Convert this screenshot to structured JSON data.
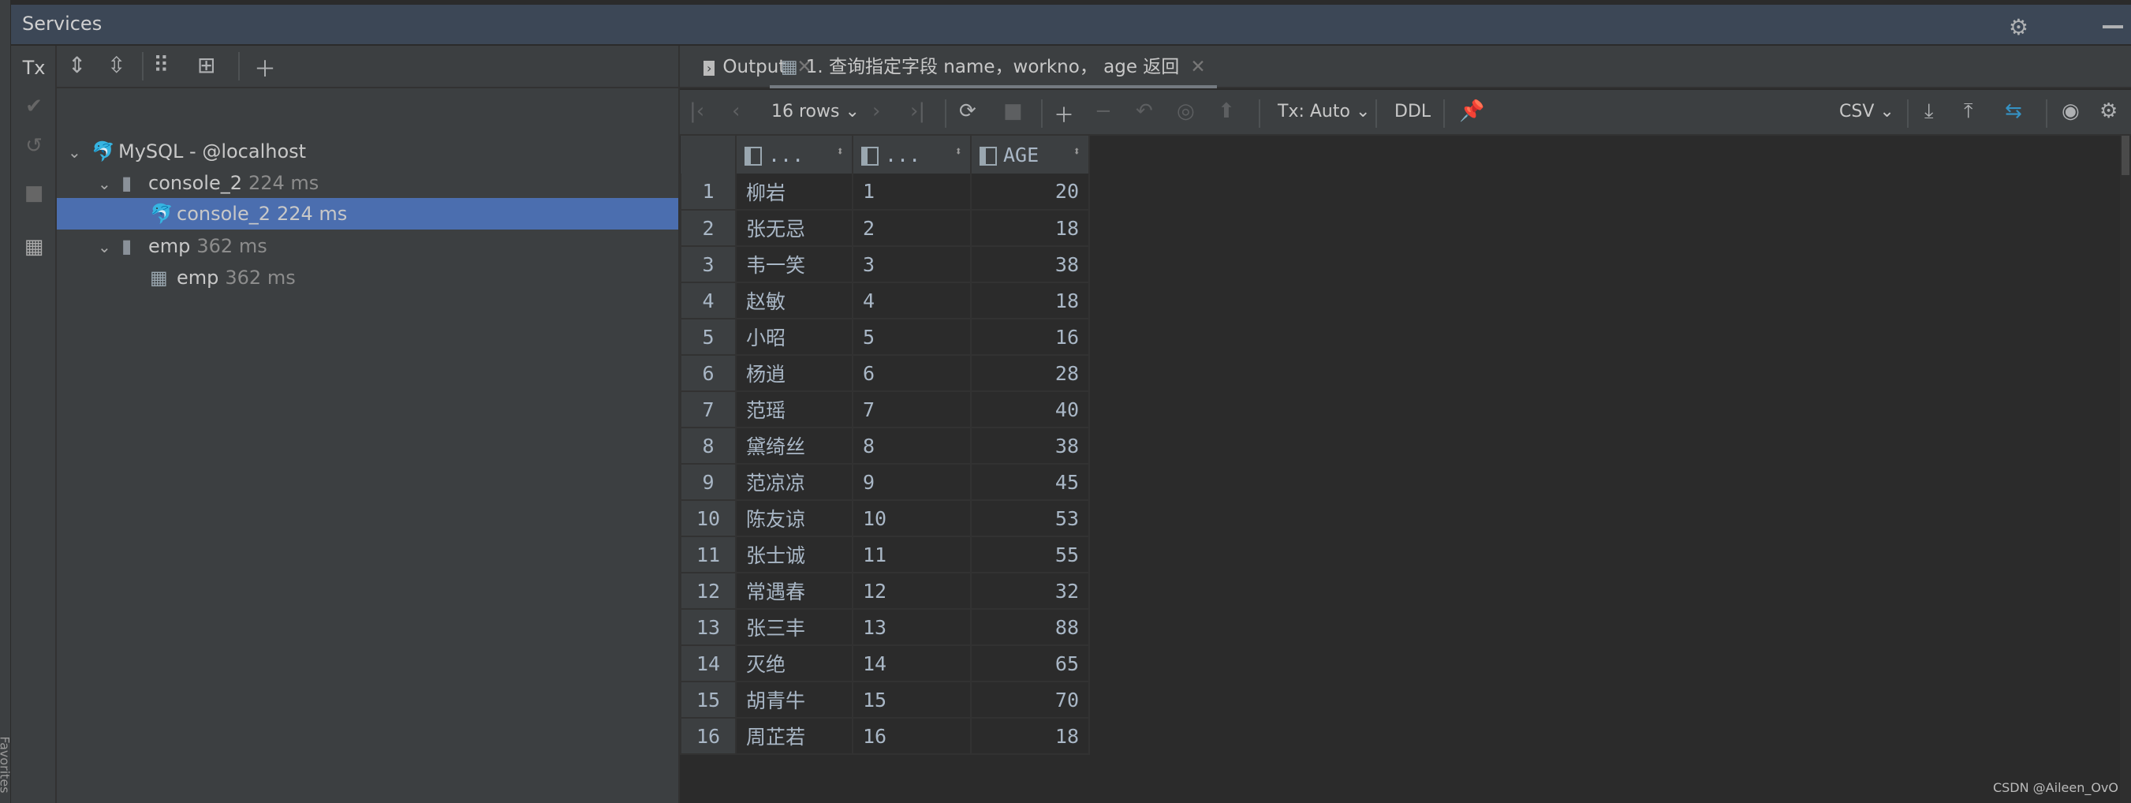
{
  "window": {
    "title": "Services",
    "side_label": "Favorites"
  },
  "left_toolbar": {
    "tx": "Tx"
  },
  "tree": {
    "nodes": [
      {
        "label": "MySQL - @localhost",
        "time": ""
      },
      {
        "label": "console_2",
        "time": "224 ms"
      },
      {
        "label": "console_2",
        "time": "224 ms"
      },
      {
        "label": "emp",
        "time": "362 ms"
      },
      {
        "label": "emp",
        "time": "362 ms"
      }
    ]
  },
  "tabs": [
    {
      "label": "Output"
    },
    {
      "label": "1. 查询指定字段 name，workno， age 返回"
    }
  ],
  "result_toolbar": {
    "rows": "16 rows",
    "tx": "Tx: Auto",
    "ddl": "DDL",
    "format": "CSV"
  },
  "table": {
    "headers": [
      "...",
      "...",
      "AGE"
    ],
    "rows": [
      [
        "1",
        "柳岩",
        "1",
        "20"
      ],
      [
        "2",
        "张无忌",
        "2",
        "18"
      ],
      [
        "3",
        "韦一笑",
        "3",
        "38"
      ],
      [
        "4",
        "赵敏",
        "4",
        "18"
      ],
      [
        "5",
        "小昭",
        "5",
        "16"
      ],
      [
        "6",
        "杨逍",
        "6",
        "28"
      ],
      [
        "7",
        "范瑶",
        "7",
        "40"
      ],
      [
        "8",
        "黛绮丝",
        "8",
        "38"
      ],
      [
        "9",
        "范凉凉",
        "9",
        "45"
      ],
      [
        "10",
        "陈友谅",
        "10",
        "53"
      ],
      [
        "11",
        "张士诚",
        "11",
        "55"
      ],
      [
        "12",
        "常遇春",
        "12",
        "32"
      ],
      [
        "13",
        "张三丰",
        "13",
        "88"
      ],
      [
        "14",
        "灭绝",
        "14",
        "65"
      ],
      [
        "15",
        "胡青牛",
        "15",
        "70"
      ],
      [
        "16",
        "周芷若",
        "16",
        "18"
      ]
    ]
  },
  "watermark": "CSDN @Aileen_OvO"
}
